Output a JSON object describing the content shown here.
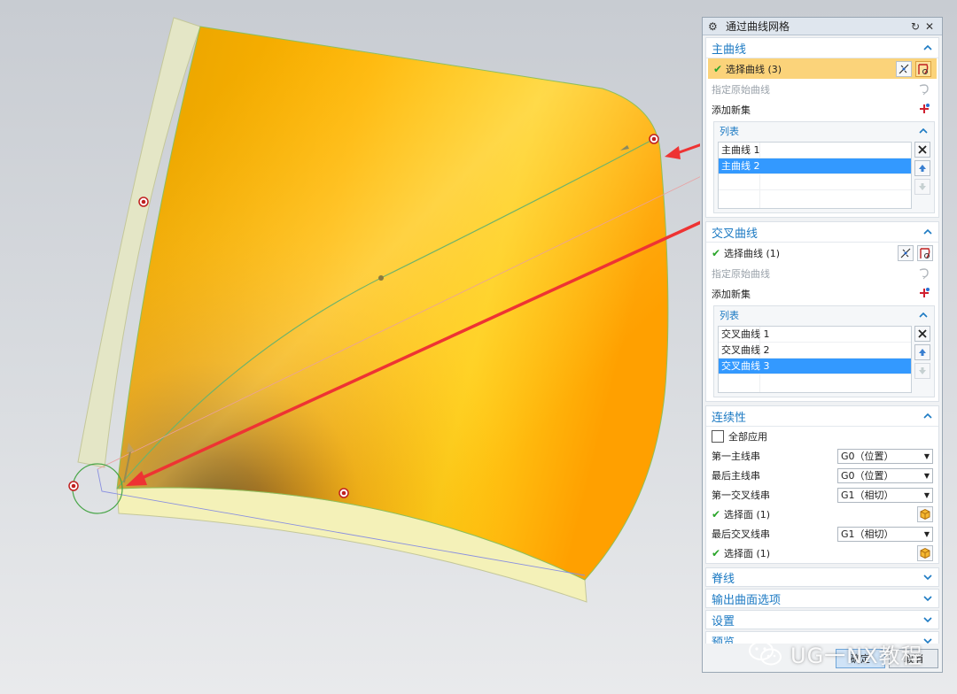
{
  "dialog": {
    "title": "通过曲线网格",
    "primary": {
      "header": "主曲线",
      "select_curve": "选择曲线 (3)",
      "specify_origin": "指定原始曲线",
      "add_set": "添加新集",
      "list_header": "列表",
      "items": [
        "主曲线 1",
        "主曲线 2"
      ],
      "selected_index": 1
    },
    "cross": {
      "header": "交叉曲线",
      "select_curve": "选择曲线 (1)",
      "specify_origin": "指定原始曲线",
      "add_set": "添加新集",
      "list_header": "列表",
      "items": [
        "交叉曲线 1",
        "交叉曲线 2",
        "交叉曲线 3"
      ],
      "selected_index": 2
    },
    "continuity": {
      "header": "连续性",
      "apply_all": "全部应用",
      "first_primary": "第一主线串",
      "first_primary_value": "G0（位置）",
      "last_primary": "最后主线串",
      "last_primary_value": "G0（位置）",
      "first_cross": "第一交叉线串",
      "first_cross_value": "G1（相切）",
      "select_face_1": "选择面 (1)",
      "last_cross": "最后交叉线串",
      "last_cross_value": "G1（相切）",
      "select_face_2": "选择面 (1)"
    },
    "collapsed_groups": [
      "脊线",
      "输出曲面选项",
      "设置",
      "预览"
    ],
    "footer": {
      "ok": "确定",
      "cancel": "取消"
    }
  },
  "watermark": {
    "text": "UG一NX教程"
  },
  "colors": {
    "accent": "#1c7ac3",
    "highlight_row": "#fbd37a",
    "list_selection": "#3399ff",
    "surface": "#ffb000",
    "arrow": "#ee3333"
  }
}
